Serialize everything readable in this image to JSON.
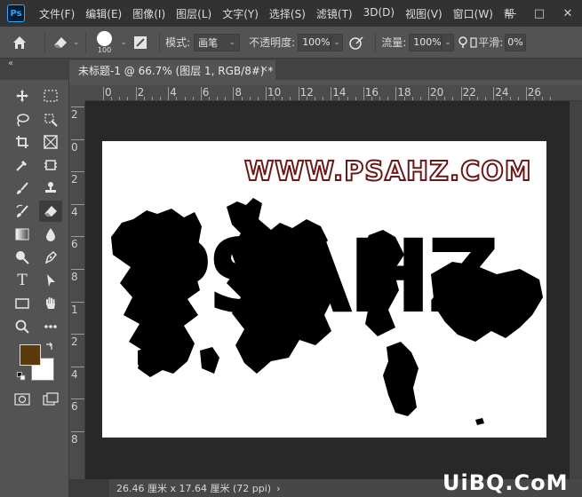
{
  "app": {
    "logo_text": "Ps",
    "menu": [
      "文件(F)",
      "编辑(E)",
      "图像(I)",
      "图层(L)",
      "文字(Y)",
      "选择(S)",
      "滤镜(T)",
      "3D(D)",
      "视图(V)",
      "窗口(W)",
      "帮"
    ],
    "window_controls": {
      "minimize": "—",
      "maximize": "□",
      "close": "✕"
    }
  },
  "options": {
    "brush_size": "100",
    "mode_label": "模式:",
    "mode_value": "画笔",
    "opacity_label": "不透明度:",
    "opacity_value": "100%",
    "flow_label": "流量:",
    "flow_value": "100%",
    "smooth_label": "平滑:",
    "smooth_value": "0%"
  },
  "document": {
    "tab_title": "未标题-1 @ 66.7% (图层 1, RGB/8#) *",
    "tab_close": "×",
    "collapse_glyph": "«"
  },
  "rulers": {
    "top_ticks": [
      "0",
      "2",
      "4",
      "6",
      "8",
      "10",
      "12",
      "14",
      "16",
      "18",
      "20",
      "22",
      "24",
      "26"
    ],
    "left_ticks": [
      "2",
      "0",
      "2",
      "4",
      "6",
      "8",
      "1",
      "2",
      "4",
      "6",
      "8"
    ]
  },
  "canvas": {
    "watermark": "WWW.PSAHZ.COM",
    "art_text": "PSAHZ"
  },
  "status": {
    "dimensions": "26.46 厘米 x 17.64 厘米 (72 ppi)",
    "arrow": "›"
  },
  "site_logo": "UiBQ.CoM",
  "colors": {
    "foreground": "#5a3a0a",
    "background": "#ffffff",
    "watermark_stroke": "#6a1717"
  },
  "icons": [
    "home-icon",
    "eraser-icon",
    "brush-tip-icon",
    "brush-panel-icon",
    "airbrush-icon",
    "move-icon",
    "marquee-icon",
    "lasso-icon",
    "magic-wand-icon",
    "crop-icon",
    "frame-icon",
    "eyedropper-icon",
    "patch-icon",
    "brush-icon",
    "stamp-icon",
    "history-brush-icon",
    "eraser-icon",
    "gradient-icon",
    "blur-icon",
    "dodge-icon",
    "pen-icon",
    "type-icon",
    "path-select-icon",
    "rectangle-icon",
    "hand-icon",
    "zoom-icon",
    "more-icon",
    "swap-icon",
    "default-colors-icon",
    "quick-mask-icon",
    "screen-mode-icon"
  ]
}
